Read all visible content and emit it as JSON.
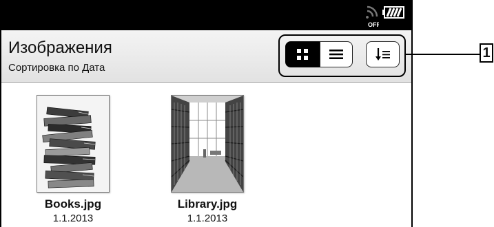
{
  "status": {
    "wifi_icon": "wifi-off-icon",
    "wifi_label": "OFF",
    "battery_icon": "battery-icon"
  },
  "header": {
    "title": "Изображения",
    "subtitle": "Сортировка по Дата"
  },
  "toolbar": {
    "grid_icon": "grid-view-icon",
    "list_icon": "list-view-icon",
    "sort_icon": "sort-icon",
    "active_view": "grid"
  },
  "callout": {
    "label": "1"
  },
  "items": [
    {
      "name": "Books.jpg",
      "date": "1.1.2013",
      "thumb_icon": "books-image"
    },
    {
      "name": "Library.jpg",
      "date": "1.1.2013",
      "thumb_icon": "library-image"
    }
  ]
}
